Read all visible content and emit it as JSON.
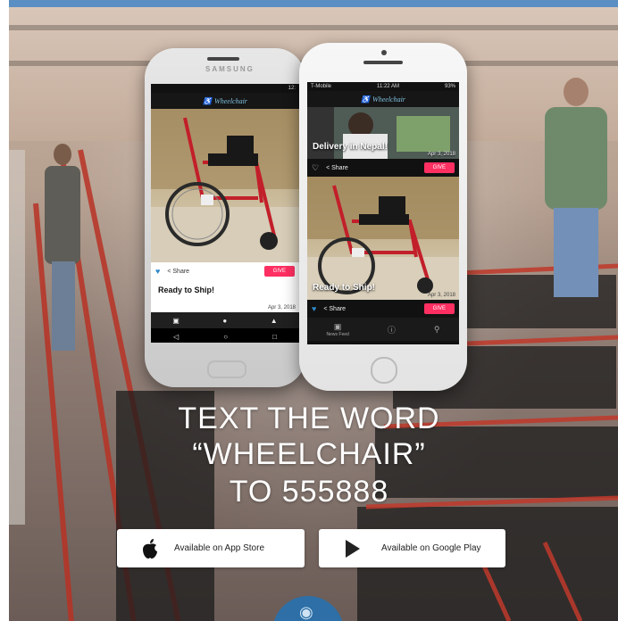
{
  "left_phone": {
    "brand": "SAMSUNG",
    "status_time": "12:",
    "app_logo": "Wheelchair",
    "card_title": "Ready to Ship!",
    "card_date": "Apr 3, 2018",
    "share_label": "Share",
    "give_label": "GIVE"
  },
  "right_phone": {
    "carrier": "T-Mobile",
    "status_time": "11:22 AM",
    "battery": "93%",
    "app_logo": "Wheelchair",
    "card1_caption": "Delivery in Nepal!",
    "card1_date": "Apr 3, 2018",
    "card2_caption": "Ready to Ship!",
    "card2_date": "Apr 3, 2018",
    "share_label": "Share",
    "give_label": "GIVE",
    "nav_news_feed": "News Feed"
  },
  "headline": {
    "line1": "TEXT THE WORD",
    "line2": "“WHEELCHAIR”",
    "line3": "TO 555888"
  },
  "stores": {
    "app_store": "Available on App Store",
    "google_play": "Available on Google Play"
  },
  "colors": {
    "give_button": "#ff2f62",
    "like_heart": "#2e88c8",
    "brand_blue": "#2d6fa6"
  }
}
